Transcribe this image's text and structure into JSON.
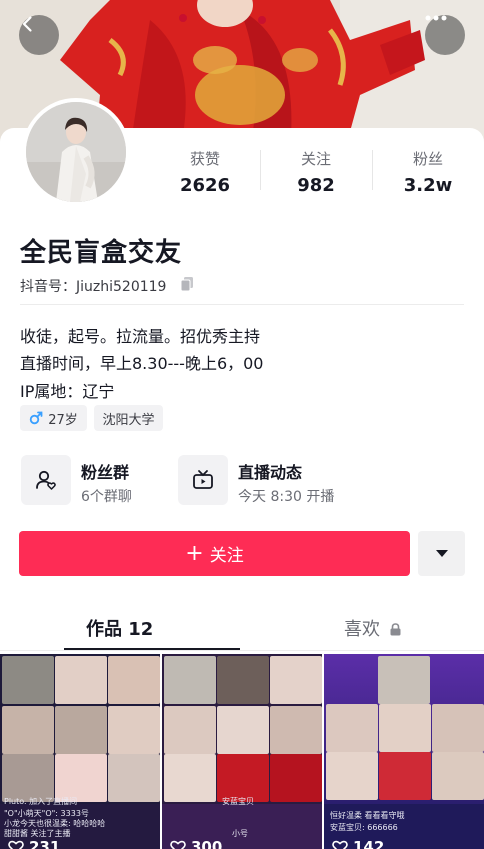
{
  "nav": {
    "back_icon": "chevron-left-icon",
    "more_icon": "more-horizontal-icon"
  },
  "profile": {
    "name": "全民盲盒交友",
    "douyin_id": "抖音号：Jiuzhi520119",
    "stats": [
      {
        "label": "获赞",
        "value": "2626"
      },
      {
        "label": "关注",
        "value": "982"
      },
      {
        "label": "粉丝",
        "value": "3.2w"
      }
    ],
    "bio": [
      "收徒，起号。拉流量。招优秀主持",
      "直播时间，早上8.30---晚上6，00",
      "IP属地：辽宁"
    ],
    "tags": {
      "age": "27岁",
      "school": "沈阳大学",
      "gender_icon": "male-icon"
    }
  },
  "entries": {
    "fans_group": {
      "title": "粉丝群",
      "subtitle": "6个群聊",
      "icon": "fans-group-icon"
    },
    "live": {
      "title": "直播动态",
      "subtitle": "今天 8:30 开播",
      "icon": "tv-icon"
    }
  },
  "actions": {
    "follow_plus": "+",
    "follow_label": "关注",
    "dropdown_icon": "caret-down-icon"
  },
  "tabs": {
    "works": "作品 12",
    "likes": "喜欢",
    "likes_icon": "lock-icon"
  },
  "videos": [
    {
      "likes": "231",
      "overlay": [
        "Pluto. 加入了直播间",
        "\"O\"小萌天\"O\": 3333号",
        "小龙今天也很温柔: 哈哈哈哈",
        "甜甜酱 关注了主播"
      ]
    },
    {
      "likes": "300",
      "overlay": [
        "安蓝宝贝",
        "小号"
      ]
    },
    {
      "likes": "142",
      "overlay": [
        "恒好温柔 看看看守哦",
        "安蓝宝贝: 666666"
      ]
    }
  ],
  "colors": {
    "accent": "#fe2c55",
    "text_primary": "#161823",
    "text_secondary": "#6b6d75",
    "male_blue": "#3aa0ff",
    "chip_bg": "#f2f2f4"
  }
}
